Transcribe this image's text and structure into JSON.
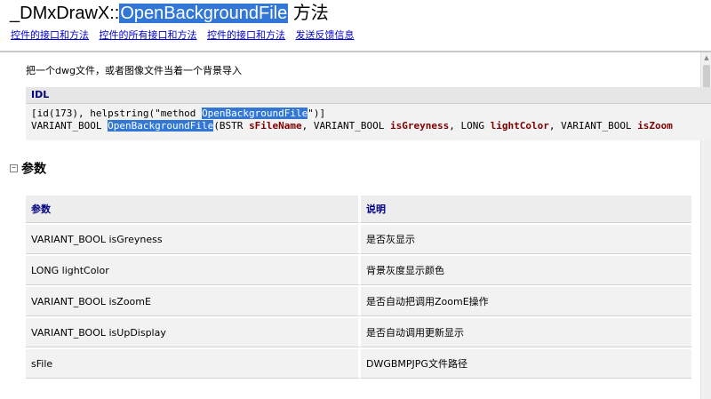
{
  "header": {
    "title_prefix": "_DMxDrawX::",
    "title_method": "OpenBackgroundFile",
    "title_suffix": " 方法",
    "links": [
      "控件的接口和方法",
      "控件的所有接口和方法",
      "控件的接口和方法",
      "发送反馈信息"
    ]
  },
  "description": "把一个dwg文件，或者图像文件当着一个背景导入",
  "idl": {
    "heading": "IDL",
    "line1_a": "[id(173), helpstring(\"method ",
    "line1_sel": "OpenBackgroundFile",
    "line1_b": "\")]",
    "line2_a": "VARIANT_BOOL ",
    "line2_sel": "OpenBackgroundFile",
    "line2_b": "(BSTR ",
    "p1": "sFileName",
    "sep1": ", VARIANT_BOOL ",
    "p2": "isGreyness",
    "sep2": ", LONG ",
    "p3": "lightColor",
    "sep3": ", VARIANT_BOOL ",
    "p4": "isZoom"
  },
  "params_section": {
    "toggle": "−",
    "title": "参数",
    "headers": [
      "参数",
      "说明"
    ],
    "rows": [
      [
        "VARIANT_BOOL isGreyness",
        "是否灰显示"
      ],
      [
        "LONG lightColor",
        "背景灰度显示颜色"
      ],
      [
        "VARIANT_BOOL isZoomE",
        "是否自动把调用ZoomE操作"
      ],
      [
        "VARIANT_BOOL isUpDisplay",
        "是否自动调用更新显示"
      ],
      [
        "sFile",
        "DWGBMPJPG文件路径"
      ]
    ]
  },
  "scrollbar": {
    "up_arrow": "▲"
  }
}
